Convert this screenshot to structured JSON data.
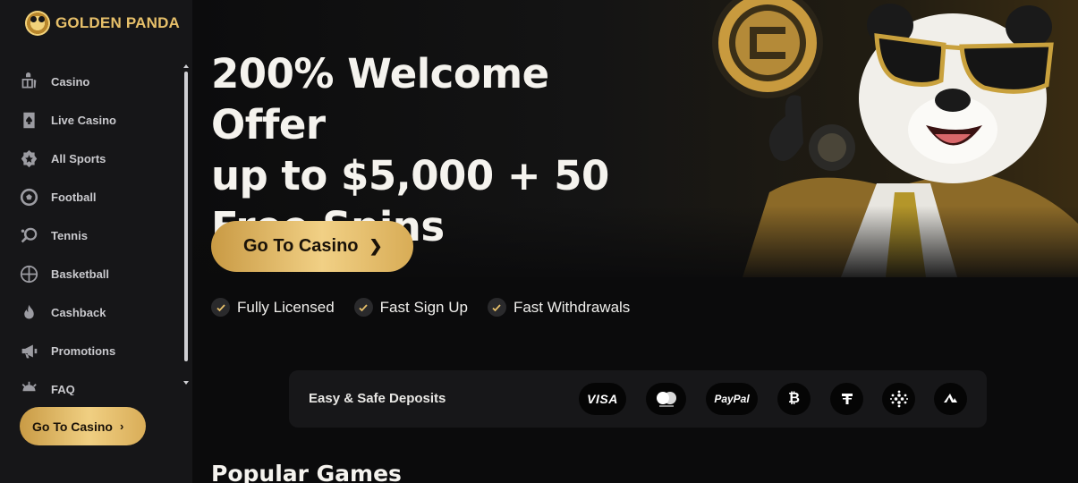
{
  "brand": {
    "name": "GOLDEN PANDA",
    "logo_icon": "panda-coin-logo",
    "accent": "#e7c06a"
  },
  "sidebar": {
    "items": [
      {
        "label": "Casino",
        "icon": "casino-icon"
      },
      {
        "label": "Live Casino",
        "icon": "playing-card-icon"
      },
      {
        "label": "All Sports",
        "icon": "sports-badge-icon"
      },
      {
        "label": "Football",
        "icon": "football-icon"
      },
      {
        "label": "Tennis",
        "icon": "tennis-racket-icon"
      },
      {
        "label": "Basketball",
        "icon": "basketball-icon"
      },
      {
        "label": "Cashback",
        "icon": "flame-icon"
      },
      {
        "label": "Promotions",
        "icon": "megaphone-icon"
      },
      {
        "label": "FAQ",
        "icon": "sun-icon"
      }
    ],
    "cta_label": "Go To Casino"
  },
  "hero": {
    "title_line1": "200% Welcome Offer",
    "title_line2": "up to $5,000 + 50",
    "title_line3": "Free Spins",
    "cta_label": "Go To Casino",
    "features": [
      {
        "label": "Fully Licensed"
      },
      {
        "label": "Fast Sign Up"
      },
      {
        "label": "Fast Withdrawals"
      }
    ]
  },
  "deposits": {
    "label": "Easy & Safe Deposits",
    "methods": [
      {
        "name": "VISA",
        "icon": "visa-icon"
      },
      {
        "name": "mastercard",
        "icon": "mastercard-icon"
      },
      {
        "name": "PayPal",
        "icon": "paypal-icon"
      },
      {
        "name": "Bitcoin",
        "icon": "bitcoin-icon"
      },
      {
        "name": "Tether",
        "icon": "tether-icon"
      },
      {
        "name": "Cardano",
        "icon": "cardano-icon"
      },
      {
        "name": "Avalanche",
        "icon": "avalanche-icon"
      }
    ]
  },
  "sections": {
    "popular_title": "Popular Games"
  }
}
